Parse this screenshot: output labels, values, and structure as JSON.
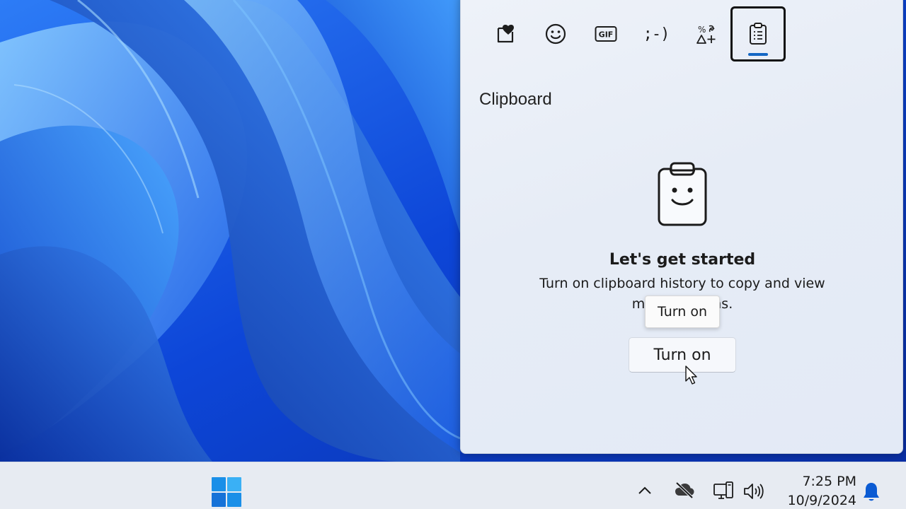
{
  "panel": {
    "tabs": [
      {
        "name": "favorites",
        "icon": "heart-note-icon",
        "active": false
      },
      {
        "name": "emoji",
        "icon": "smiley-icon",
        "active": false
      },
      {
        "name": "gif",
        "icon": "gif-icon",
        "label": "GIF",
        "active": false
      },
      {
        "name": "kaomoji",
        "icon": "kaomoji-icon",
        "label": ";-)",
        "active": false
      },
      {
        "name": "symbols",
        "icon": "symbols-icon",
        "active": false
      },
      {
        "name": "clipboard",
        "icon": "clipboard-icon",
        "active": true
      }
    ],
    "title": "Clipboard",
    "empty_state": {
      "heading": "Let's get started",
      "description": "Turn on clipboard history to copy and view multiple items."
    },
    "turn_on_button": "Turn on",
    "tooltip": "Turn on",
    "colors": {
      "accent": "#1467c4"
    }
  },
  "taskbar": {
    "start_icon": "windows-logo-icon",
    "tray_icons": [
      "chevron-up-icon",
      "cloud-off-icon",
      "network-icon",
      "speaker-icon",
      "bell-icon"
    ],
    "time": "7:25 PM",
    "date": "10/9/2024",
    "colors": {
      "start": "#1a8fe8",
      "bell": "#0b5bd3"
    }
  }
}
